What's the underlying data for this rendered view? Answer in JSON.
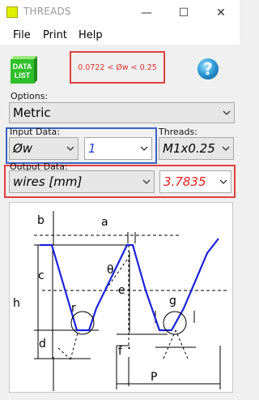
{
  "window": {
    "title": "THREADS",
    "minimize": "—",
    "maximize": "☐",
    "close": "✕"
  },
  "menu": {
    "file": "File",
    "print": "Print",
    "help": "Help"
  },
  "toolbar": {
    "datalist_line1": "DATA",
    "datalist_line2": "LIST",
    "help_symbol": "?",
    "expression": "0.0722 < Øw < 0.25"
  },
  "options": {
    "label": "Options:",
    "value": "Metric"
  },
  "input": {
    "label": "Input Data:",
    "param": "Øw",
    "value": "1"
  },
  "threads": {
    "label": "Threads:",
    "value": "M1x0.25"
  },
  "output": {
    "label": "Output Data:",
    "param": "wires [mm]",
    "value": "3.7835"
  },
  "diagram": {
    "labels": {
      "a": "a",
      "b": "b",
      "c": "c",
      "d": "d",
      "e": "e",
      "f": "f",
      "g": "g",
      "h": "h",
      "r": "r",
      "theta": "θ",
      "P": "P"
    },
    "colors": {
      "profile": "#1a22d8",
      "dim": "#000000"
    }
  }
}
